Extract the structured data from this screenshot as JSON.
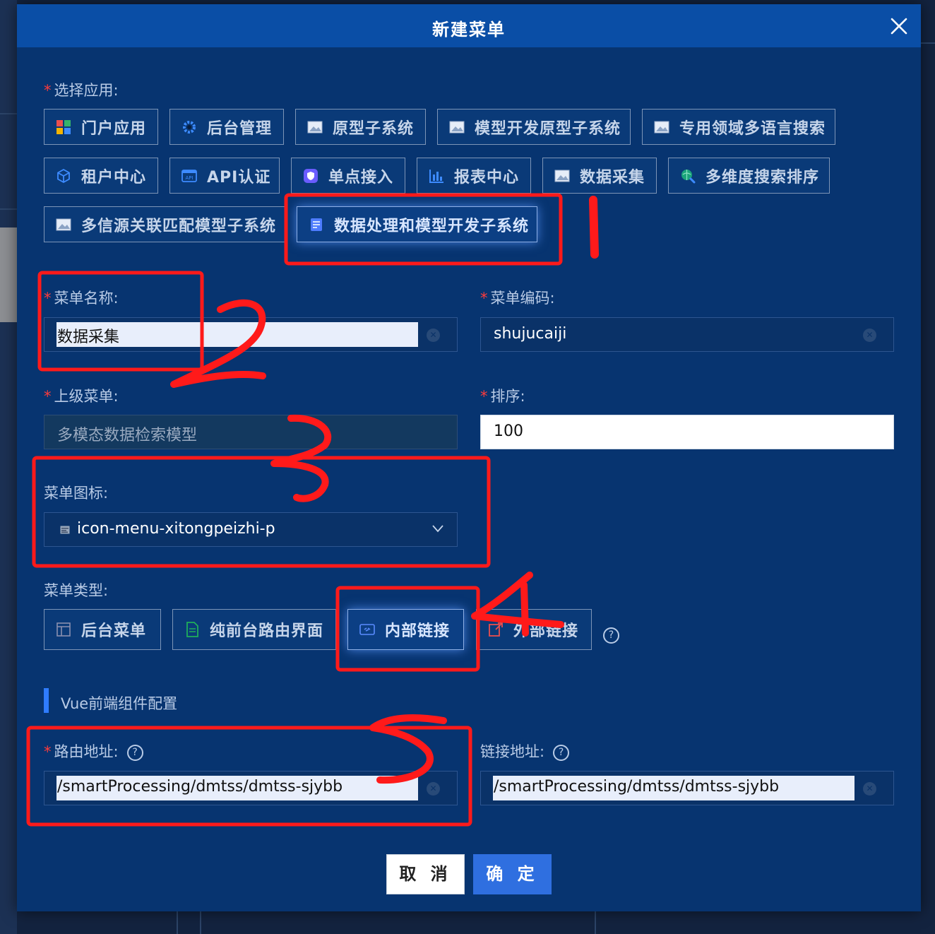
{
  "dialog": {
    "title": "新建菜单"
  },
  "select_app": {
    "label": "选择应用:",
    "options": [
      {
        "label": "门户应用",
        "icon": "portal-app-icon"
      },
      {
        "label": "后台管理",
        "icon": "gear-icon"
      },
      {
        "label": "原型子系统",
        "icon": "image-icon"
      },
      {
        "label": "模型开发原型子系统",
        "icon": "image-icon"
      },
      {
        "label": "专用领域多语言搜索",
        "icon": "image-icon"
      },
      {
        "label": "租户中心",
        "icon": "cube-icon"
      },
      {
        "label": "API认证",
        "icon": "api-icon"
      },
      {
        "label": "单点接入",
        "icon": "shield-icon"
      },
      {
        "label": "报表中心",
        "icon": "bar-chart-icon"
      },
      {
        "label": "数据采集",
        "icon": "image-icon"
      },
      {
        "label": "多维度搜索排序",
        "icon": "search-globe-icon"
      },
      {
        "label": "多信源关联匹配模型子系统",
        "icon": "image-icon"
      },
      {
        "label": "数据处理和模型开发子系统",
        "icon": "data-model-icon"
      }
    ],
    "selected": "数据处理和模型开发子系统"
  },
  "menu_name": {
    "label": "菜单名称:",
    "value": "数据采集"
  },
  "menu_code": {
    "label": "菜单编码:",
    "value": "shujucaiji"
  },
  "parent_menu": {
    "label": "上级菜单:",
    "value": "多模态数据检索模型"
  },
  "sort": {
    "label": "排序:",
    "value": "100"
  },
  "menu_icon": {
    "label": "菜单图标:",
    "value": "icon-menu-xitongpeizhi-p",
    "icon": "menu-item-icon"
  },
  "menu_type": {
    "label": "菜单类型:",
    "options": [
      {
        "label": "后台菜单",
        "icon": "layout-icon"
      },
      {
        "label": "纯前台路由界面",
        "icon": "document-icon"
      },
      {
        "label": "内部链接",
        "icon": "link-icon"
      },
      {
        "label": "外部链接",
        "icon": "external-link-icon"
      }
    ],
    "selected": "内部链接"
  },
  "vue_section": {
    "title": "Vue前端组件配置"
  },
  "route_address": {
    "label": "路由地址:",
    "value": "/smartProcessing/dmtss/dmtss-sjybb"
  },
  "link_address": {
    "label": "链接地址:",
    "value": "/smartProcessing/dmtss/dmtss-sjybb"
  },
  "help_glyph": "?",
  "buttons": {
    "cancel": "取 消",
    "confirm": "确 定"
  },
  "colors": {
    "dialog_bg": "#073470",
    "header_bg": "#0a4ea6",
    "primary": "#2f6fe0",
    "required": "#ff3b3b",
    "annotation": "#ff1a1a"
  }
}
